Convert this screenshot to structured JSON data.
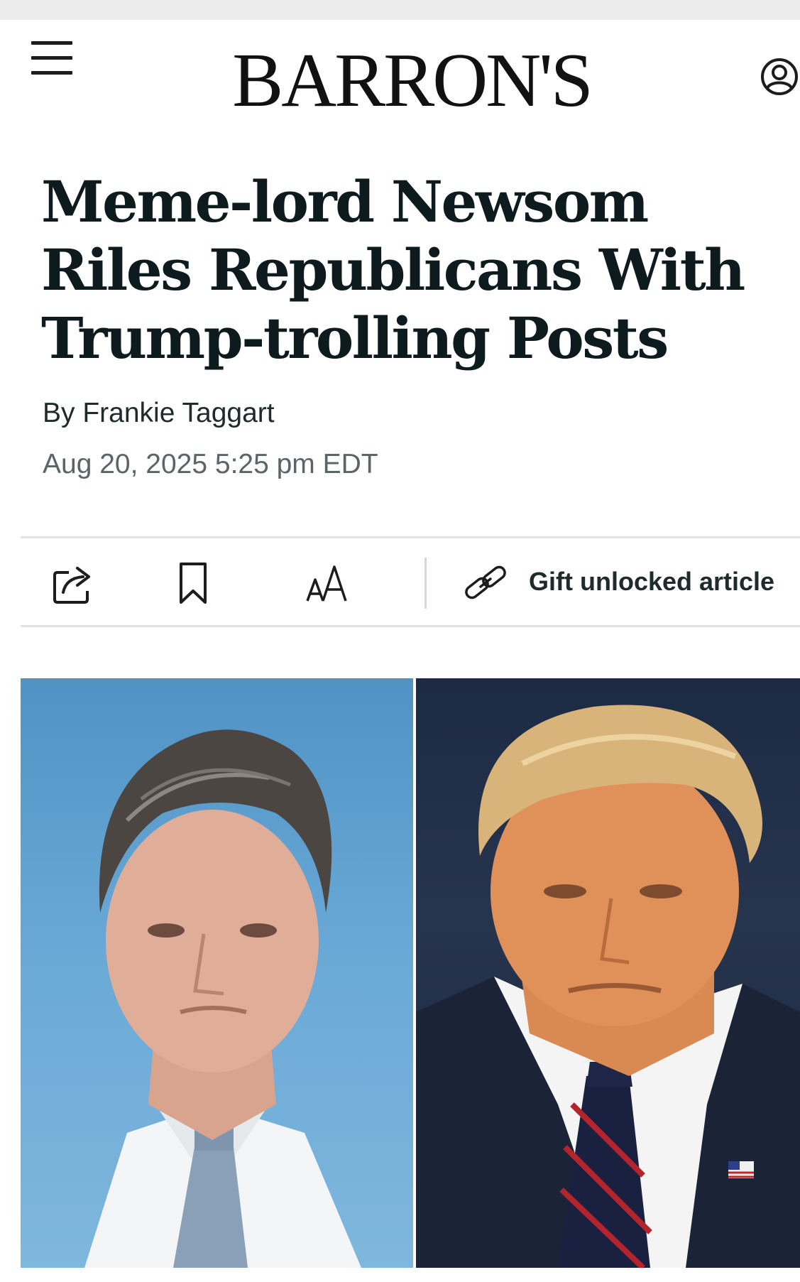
{
  "site": {
    "logo_text": "BARRON'S"
  },
  "header": {
    "menu_icon": "hamburger-menu-icon",
    "account_icon": "user-account-icon"
  },
  "article": {
    "headline": "Meme-lord Newsom Riles Republicans With Trump-trolling Posts",
    "byline_prefix": "By",
    "author": "Frankie Taggart",
    "timestamp": "Aug 20, 2025 5:25 pm EDT"
  },
  "toolbar": {
    "share_icon": "share-icon",
    "bookmark_icon": "bookmark-icon",
    "text_size_icon": "text-size-icon",
    "link_icon": "link-icon",
    "gift_label": "Gift unlocked article"
  },
  "hero_image": {
    "panels": [
      "photo-left",
      "photo-right"
    ]
  },
  "colors": {
    "headline": "#0e1b1e",
    "body_text": "#1f2a2b",
    "muted_text": "#5b6466",
    "divider": "#e3e3e3",
    "sky_blue": "#69a8d6",
    "navy_backdrop": "#1d2a44"
  }
}
